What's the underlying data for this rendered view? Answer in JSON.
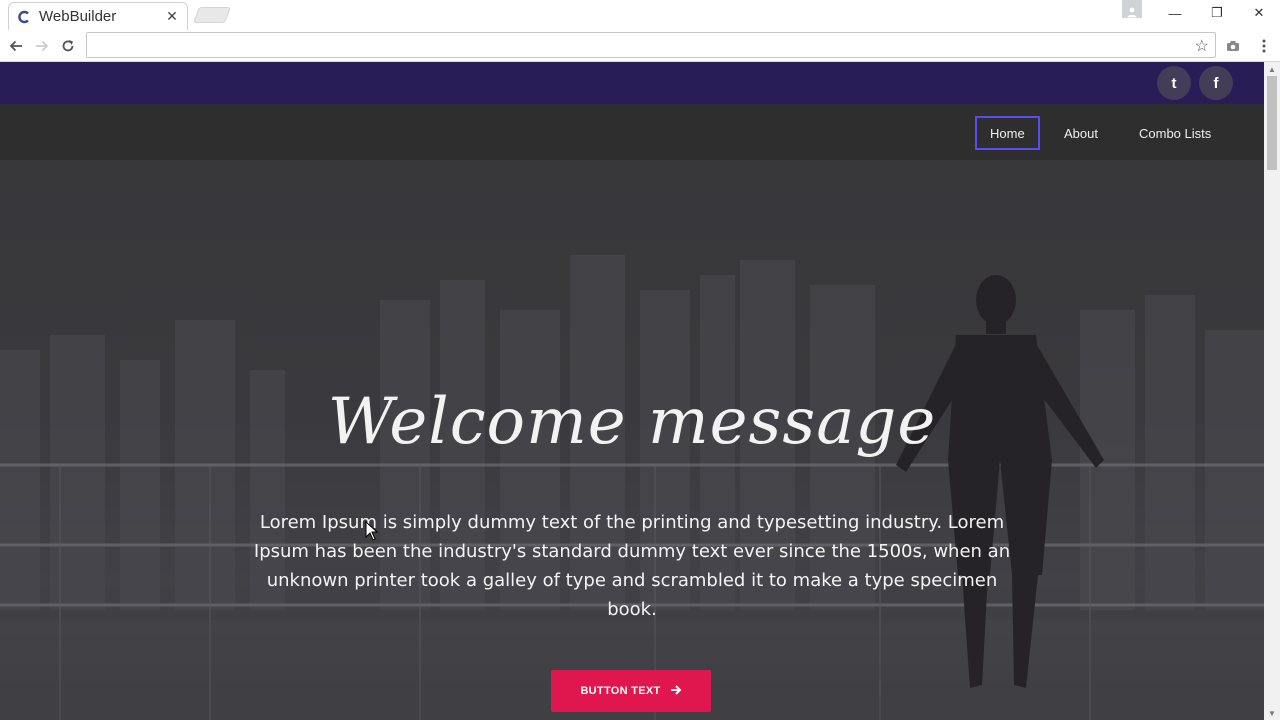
{
  "browser": {
    "tab_title": "WebBuilder",
    "tab_close": "✕",
    "address_value": "",
    "controls": {
      "minimize": "—",
      "maximize": "❐",
      "close": "✕"
    }
  },
  "site": {
    "brand_color": "#281d56",
    "accent_color": "#e0174f",
    "active_border_color": "#5a4cf0",
    "social": [
      {
        "label": "t",
        "icon": "twitter-icon"
      },
      {
        "label": "f",
        "icon": "facebook-icon"
      }
    ],
    "nav": [
      {
        "label": "Home",
        "active": true
      },
      {
        "label": "About",
        "active": false
      },
      {
        "label": "Combo Lists",
        "active": false
      }
    ],
    "hero": {
      "title": "Welcome message",
      "text": "Lorem Ipsum is simply dummy text of the printing and typesetting industry. Lorem Ipsum has been the industry's standard dummy text ever since the 1500s, when an unknown printer took a galley of type and scrambled it to make a type specimen book.",
      "button_label": "BUTTON TEXT",
      "button_icon": "arrow-right-icon"
    }
  }
}
